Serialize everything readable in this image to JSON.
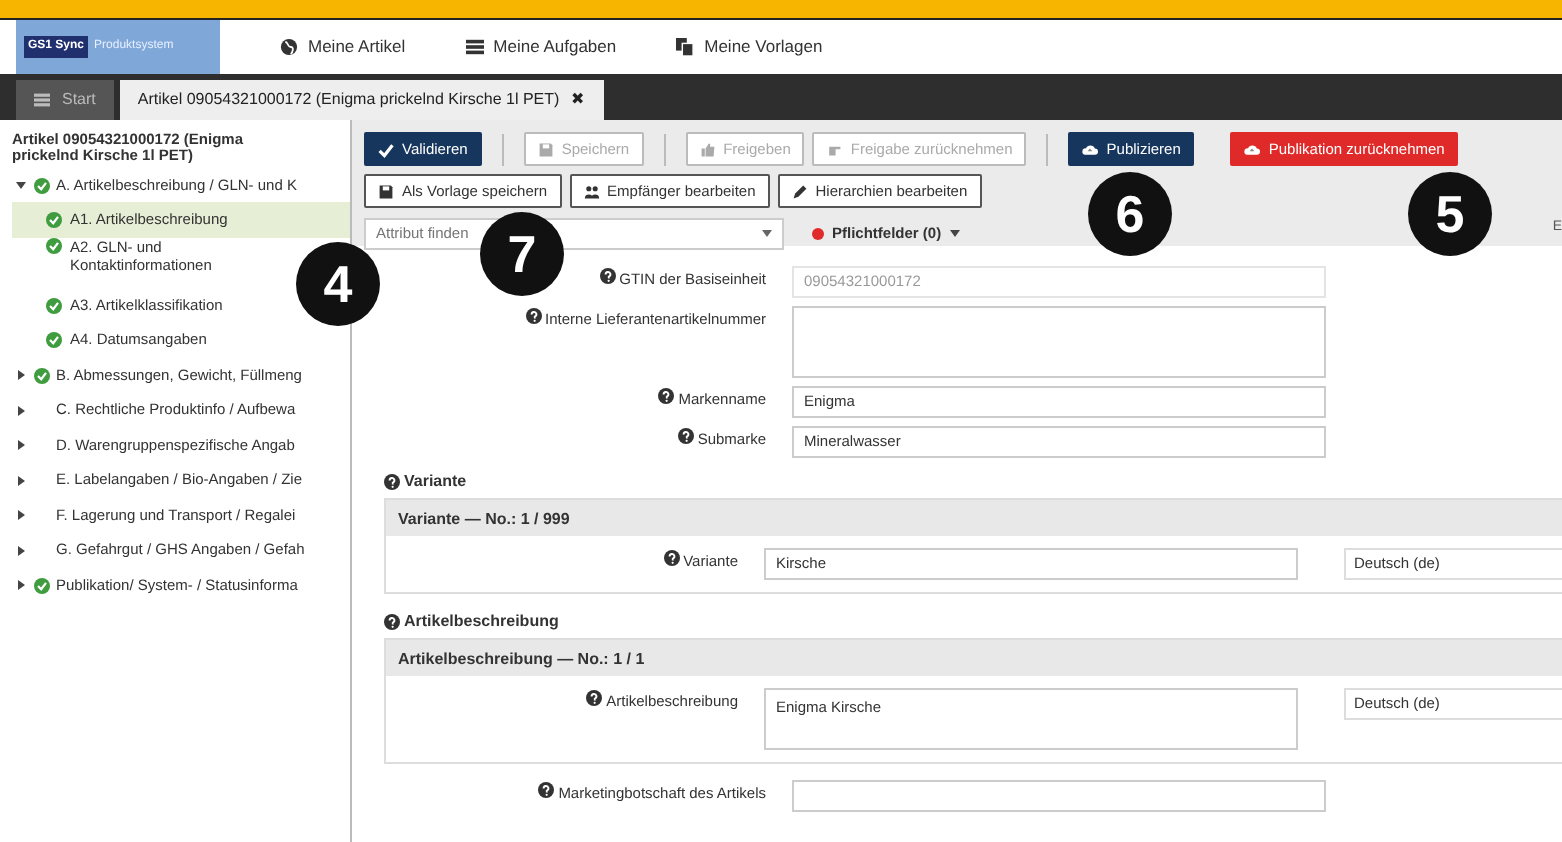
{
  "nav": {
    "logo_badge": "GS1 Sync",
    "logo_text": "Produktsystem",
    "items": [
      {
        "label": "Meine Artikel"
      },
      {
        "label": "Meine Aufgaben"
      },
      {
        "label": "Meine Vorlagen"
      }
    ]
  },
  "tabs": [
    {
      "label": "Start",
      "selected": false
    },
    {
      "label": "Artikel 09054321000172 (Enigma prickelnd Kirsche 1l PET)",
      "selected": true,
      "close": "✖"
    }
  ],
  "sidebar": {
    "title": "Artikel 09054321000172 (Enigma prickelnd Kirsche 1l PET)",
    "items": [
      {
        "label": "A. Artikelbeschreibung / GLN- und K",
        "valid": true,
        "expanded": true,
        "selected": false,
        "children": [
          {
            "label": "A1. Artikelbeschreibung",
            "valid": true,
            "selected": true
          },
          {
            "label": "A2. GLN- und Kontaktinformationen",
            "valid": true,
            "selected": false
          },
          {
            "label": "A3. Artikelklassifikation",
            "valid": true,
            "selected": false
          },
          {
            "label": "A4. Datumsangaben",
            "valid": true,
            "selected": false
          }
        ]
      },
      {
        "label": "B. Abmessungen, Gewicht, Füllmeng",
        "valid": true,
        "expanded": false,
        "selected": false
      },
      {
        "label": "C. Rechtliche Produktinfo / Aufbewa",
        "valid": false,
        "expanded": false,
        "selected": false
      },
      {
        "label": "D. Warengruppenspezifische Angab",
        "valid": false,
        "expanded": false,
        "selected": false
      },
      {
        "label": "E. Labelangaben / Bio-Angaben / Zie",
        "valid": false,
        "expanded": false,
        "selected": false
      },
      {
        "label": "F. Lagerung und Transport / Regalei",
        "valid": false,
        "expanded": false,
        "selected": false
      },
      {
        "label": "G. Gefahrgut / GHS Angaben / Gefah",
        "valid": false,
        "expanded": false,
        "selected": false
      },
      {
        "label": "Publikation/ System- / Statusinforma",
        "valid": true,
        "expanded": false,
        "selected": false
      }
    ]
  },
  "toolbar": {
    "primary_actions": [
      {
        "label": "Validieren",
        "kind": "primary",
        "disabled": false
      },
      {
        "label": "Speichern",
        "kind": "default",
        "disabled": true
      },
      {
        "label": "Freigeben",
        "kind": "default",
        "disabled": true
      },
      {
        "label": "Freigabe zurücknehmen",
        "kind": "default",
        "disabled": true
      },
      {
        "label": "Publizieren",
        "kind": "primary",
        "disabled": false
      },
      {
        "label": "Publikation zurücknehmen",
        "kind": "danger",
        "disabled": false
      }
    ],
    "edit_actions": [
      {
        "label": "Als Vorlage speichern",
        "kind": "default",
        "disabled": false
      },
      {
        "label": "Empfänger bearbeiten",
        "kind": "default",
        "disabled": false
      },
      {
        "label": "Hierarchien bearbeiten",
        "kind": "default",
        "disabled": false
      }
    ],
    "filter": {
      "placeholder": "Attribut finden"
    },
    "required": {
      "label": "Pflichtfelder (0)"
    },
    "edge_text": "E"
  },
  "callouts": [
    "4",
    "7",
    "6",
    "5"
  ],
  "fields": [
    {
      "label": "GTIN der Basiseinheit",
      "value": "09054321000172",
      "kind": "input",
      "disabled": true
    },
    {
      "label": "Interne Lieferantenartikelnummer",
      "kind": "textarea",
      "disabled": false
    },
    {
      "label": "Markenname",
      "value": "Enigma",
      "kind": "input",
      "disabled": false
    },
    {
      "label": "Submarke",
      "value": "Mineralwasser",
      "kind": "input",
      "disabled": false
    }
  ],
  "sections": [
    {
      "title": "Variante",
      "header": "Variante — No.: 1 / 999",
      "rows": [
        {
          "label": "Variante",
          "value": "Kirsche",
          "kind": "input",
          "language": "Deutsch (de)"
        }
      ]
    },
    {
      "title": "Artikelbeschreibung",
      "header": "Artikelbeschreibung — No.: 1 / 1",
      "rows": [
        {
          "label": "Artikelbeschreibung",
          "value": "Enigma Kirsche",
          "kind": "textarea",
          "language": "Deutsch (de)"
        }
      ]
    }
  ],
  "trailing": {
    "label": "Marketingbotschaft des Artikels"
  }
}
